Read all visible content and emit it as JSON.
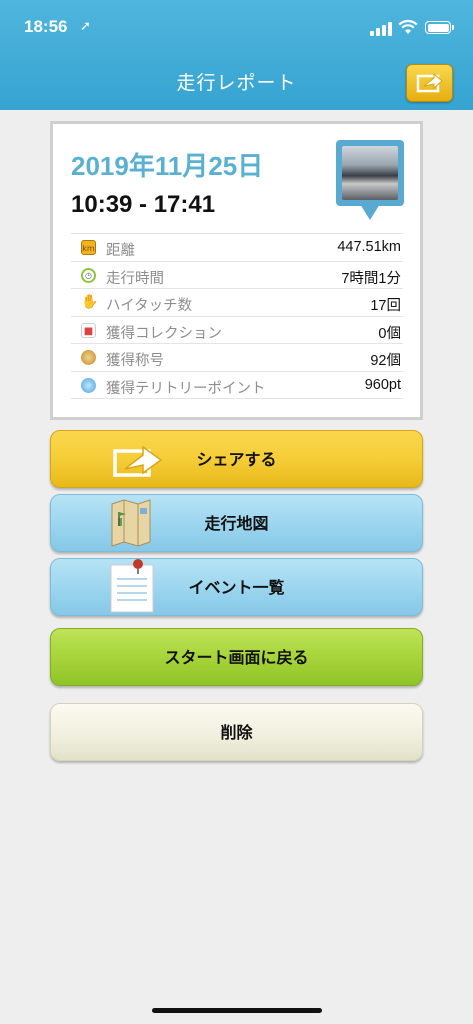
{
  "status_bar": {
    "time": "18:56"
  },
  "header": {
    "title": "走行レポート"
  },
  "report": {
    "date": "2019年11月25日",
    "time_range": "10:39 - 17:41",
    "stats": [
      {
        "label": "距離",
        "value": "447.51km",
        "icon": "distance-km-icon",
        "icon_text": "km",
        "color": "#f2b320"
      },
      {
        "label": "走行時間",
        "value": "7時間1分",
        "icon": "clock-icon",
        "icon_text": "",
        "color": "#8cc63f"
      },
      {
        "label": "ハイタッチ数",
        "value": "17回",
        "icon": "hand-icon",
        "icon_text": "",
        "color": "#4aa3df"
      },
      {
        "label": "獲得コレクション",
        "value": "0個",
        "icon": "car-card-icon",
        "icon_text": "",
        "color": "#e04040"
      },
      {
        "label": "獲得称号",
        "value": "92個",
        "icon": "medal-icon",
        "icon_text": "",
        "color": "#d4a14a"
      },
      {
        "label": "獲得テリトリーポイント",
        "value": "960pt",
        "icon": "territory-point-icon",
        "icon_text": "",
        "color": "#4aa3df"
      }
    ]
  },
  "buttons": {
    "share": "シェアする",
    "map": "走行地図",
    "events": "イベント一覧",
    "start": "スタート画面に戻る",
    "delete": "削除"
  }
}
